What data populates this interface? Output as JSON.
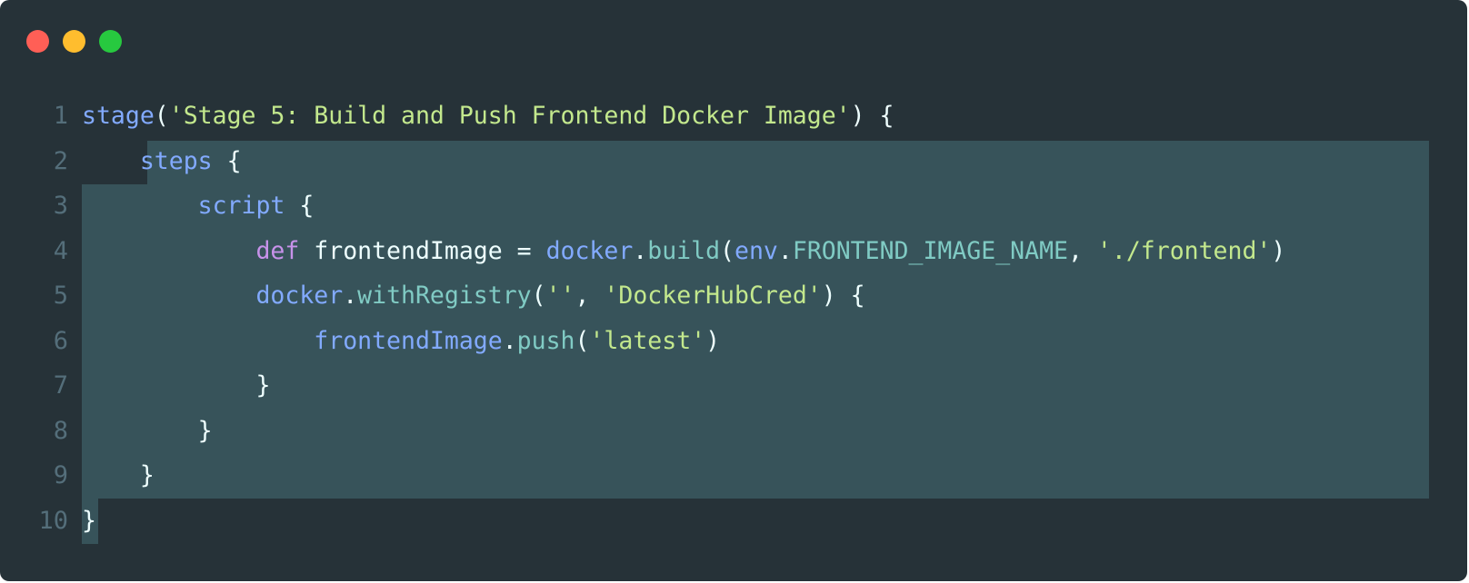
{
  "window": {
    "background": "#263238",
    "controls": [
      "close",
      "minimize",
      "maximize"
    ],
    "control_colors": {
      "close": "#ff5f56",
      "minimize": "#ffbd2e",
      "maximize": "#27c93f"
    },
    "selection_color": "#37535a"
  },
  "code": {
    "language": "groovy",
    "selected_lines": "2-10",
    "lines": [
      {
        "num": "1",
        "indent": "",
        "tokens": [
          [
            "fn",
            "stage"
          ],
          [
            "pl",
            "("
          ],
          [
            "str",
            "'Stage 5: Build and Push Frontend Docker Image'"
          ],
          [
            "pl",
            ") {"
          ]
        ]
      },
      {
        "num": "2",
        "indent": "    ",
        "tokens": [
          [
            "fn",
            "steps"
          ],
          [
            "pl",
            " {"
          ]
        ]
      },
      {
        "num": "3",
        "indent": "        ",
        "tokens": [
          [
            "fn",
            "script"
          ],
          [
            "pl",
            " {"
          ]
        ]
      },
      {
        "num": "4",
        "indent": "            ",
        "tokens": [
          [
            "kw",
            "def"
          ],
          [
            "pl",
            " frontendImage = "
          ],
          [
            "fn",
            "docker"
          ],
          [
            "pl",
            "."
          ],
          [
            "prop",
            "build"
          ],
          [
            "pl",
            "("
          ],
          [
            "fn",
            "env"
          ],
          [
            "pl",
            "."
          ],
          [
            "prop",
            "FRONTEND_IMAGE_NAME"
          ],
          [
            "pl",
            ", "
          ],
          [
            "str",
            "'./frontend'"
          ],
          [
            "pl",
            ")"
          ]
        ]
      },
      {
        "num": "5",
        "indent": "            ",
        "tokens": [
          [
            "fn",
            "docker"
          ],
          [
            "pl",
            "."
          ],
          [
            "prop",
            "withRegistry"
          ],
          [
            "pl",
            "("
          ],
          [
            "str",
            "''"
          ],
          [
            "pl",
            ", "
          ],
          [
            "str",
            "'DockerHubCred'"
          ],
          [
            "pl",
            ") {"
          ]
        ]
      },
      {
        "num": "6",
        "indent": "                ",
        "tokens": [
          [
            "fn",
            "frontendImage"
          ],
          [
            "pl",
            "."
          ],
          [
            "prop",
            "push"
          ],
          [
            "pl",
            "("
          ],
          [
            "str",
            "'latest'"
          ],
          [
            "pl",
            ")"
          ]
        ]
      },
      {
        "num": "7",
        "indent": "            ",
        "tokens": [
          [
            "pl",
            "}"
          ]
        ]
      },
      {
        "num": "8",
        "indent": "        ",
        "tokens": [
          [
            "pl",
            "}"
          ]
        ]
      },
      {
        "num": "9",
        "indent": "    ",
        "tokens": [
          [
            "pl",
            "}"
          ]
        ]
      },
      {
        "num": "10",
        "indent": "",
        "tokens": [
          [
            "pl",
            "}"
          ]
        ]
      }
    ]
  }
}
